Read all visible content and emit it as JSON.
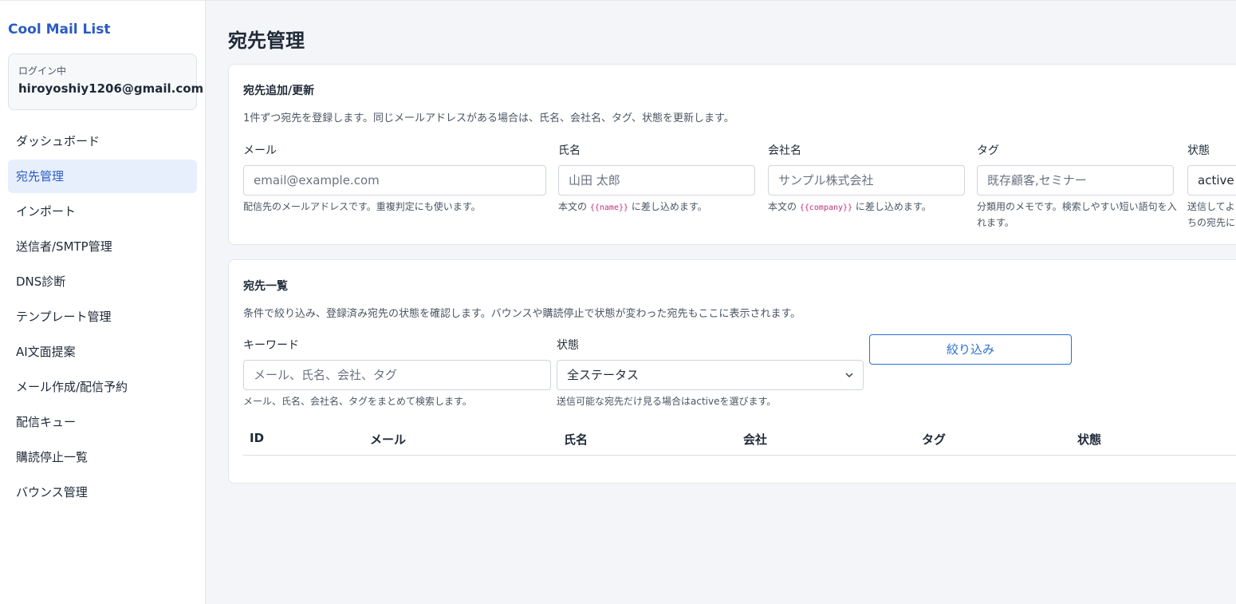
{
  "app": {
    "brand": "Cool Mail List",
    "login_label": "ログイン中",
    "login_email": "hiroyoshiy1206@gmail.com"
  },
  "nav": {
    "items": [
      {
        "label": "ダッシュボード"
      },
      {
        "label": "宛先管理"
      },
      {
        "label": "インポート"
      },
      {
        "label": "送信者/SMTP管理"
      },
      {
        "label": "DNS診断"
      },
      {
        "label": "テンプレート管理"
      },
      {
        "label": "AI文面提案"
      },
      {
        "label": "メール作成/配信予約"
      },
      {
        "label": "配信キュー"
      },
      {
        "label": "購読停止一覧"
      },
      {
        "label": "バウンス管理"
      }
    ],
    "active_index": 1
  },
  "page": {
    "title": "宛先管理"
  },
  "add_form": {
    "title": "宛先追加/更新",
    "description": "1件ずつ宛先を登録します。同じメールアドレスがある場合は、氏名、会社名、タグ、状態を更新します。",
    "email": {
      "label": "メール",
      "placeholder": "email@example.com",
      "hint": "配信先のメールアドレスです。重複判定にも使います。"
    },
    "name": {
      "label": "氏名",
      "placeholder": "山田 太郎",
      "hint_before": "本文の",
      "hint_code": "{{name}}",
      "hint_after": "に差し込めます。"
    },
    "company": {
      "label": "会社名",
      "placeholder": "サンプル株式会社",
      "hint_before": "本文の",
      "hint_code": "{{company}}",
      "hint_after": "に差し込めます。"
    },
    "tag": {
      "label": "タグ",
      "placeholder": "既存顧客,セミナー",
      "hint_line1": "分類用のメモです。検索しやすい短い語句を入",
      "hint_line2": "れます。"
    },
    "status": {
      "label": "状態",
      "value": "active",
      "hint_line1": "送信してよい",
      "hint_line2": "ちの宛先に"
    }
  },
  "list": {
    "title": "宛先一覧",
    "description": "条件で絞り込み、登録済み宛先の状態を確認します。バウンスや購読停止で状態が変わった宛先もここに表示されます。",
    "keyword": {
      "label": "キーワード",
      "placeholder": "メール、氏名、会社、タグ",
      "hint": "メール、氏名、会社名、タグをまとめて検索します。"
    },
    "status": {
      "label": "状態",
      "selected": "全ステータス",
      "hint": "送信可能な宛先だけ見る場合はactiveを選びます。"
    },
    "filter_button": "絞り込み",
    "columns": [
      "ID",
      "メール",
      "氏名",
      "会社",
      "タグ",
      "状態"
    ]
  },
  "colors": {
    "accent": "#2a5bc4",
    "active_bg": "#e8effc",
    "button": "#2a6fd6",
    "code": "#c0307a"
  }
}
